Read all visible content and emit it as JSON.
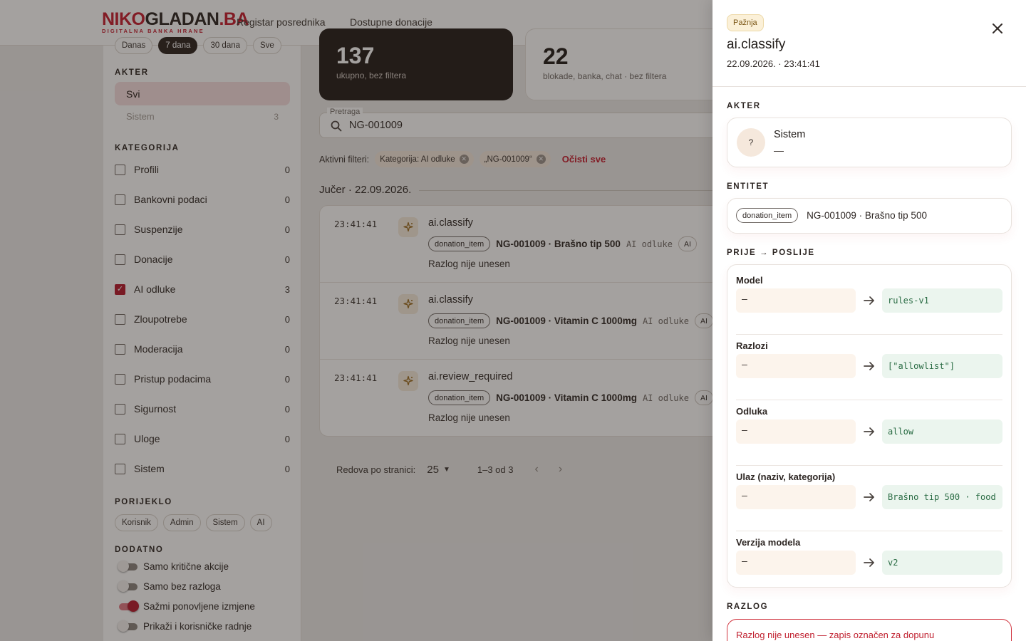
{
  "header": {
    "logo_main_red": "NIKO",
    "logo_main_dark": "GLADAN",
    "logo_main_suffix": ".BA",
    "logo_sub": "DIGITALNA BANKA HRANE",
    "nav": [
      "Registar posrednika",
      "Dostupne donacije"
    ]
  },
  "sidebar": {
    "top_chips": [
      "Danas",
      "7 dana",
      "30 dana",
      "Sve"
    ],
    "actor_title": "AKTER",
    "actors": [
      {
        "label": "Svi",
        "count": ""
      },
      {
        "label": "Sistem",
        "count": "3"
      }
    ],
    "category_title": "KATEGORIJA",
    "categories": [
      {
        "label": "Profili",
        "count": "0",
        "checked": false
      },
      {
        "label": "Bankovni podaci",
        "count": "0",
        "checked": false
      },
      {
        "label": "Suspenzije",
        "count": "0",
        "checked": false
      },
      {
        "label": "Donacije",
        "count": "0",
        "checked": false
      },
      {
        "label": "AI odluke",
        "count": "3",
        "checked": true
      },
      {
        "label": "Zloupotrebe",
        "count": "0",
        "checked": false
      },
      {
        "label": "Moderacija",
        "count": "0",
        "checked": false
      },
      {
        "label": "Pristup podacima",
        "count": "0",
        "checked": false
      },
      {
        "label": "Sigurnost",
        "count": "0",
        "checked": false
      },
      {
        "label": "Uloge",
        "count": "0",
        "checked": false
      },
      {
        "label": "Sistem",
        "count": "0",
        "checked": false
      }
    ],
    "origin_title": "PORIJEKLO",
    "origins": [
      "Korisnik",
      "Admin",
      "Sistem",
      "AI"
    ],
    "extra_title": "DODATNO",
    "toggles": [
      {
        "label": "Samo kritične akcije",
        "on": false
      },
      {
        "label": "Samo bez razloga",
        "on": false
      },
      {
        "label": "Sažmi ponovljene izmjene",
        "on": true
      },
      {
        "label": "Prikaži i korisničke radnje",
        "on": false
      }
    ]
  },
  "stats": {
    "total_num": "137",
    "total_sub": "ukupno, bez filtera",
    "critical_num": "22",
    "critical_sub": "blokade, banka, chat · bez filtera"
  },
  "search": {
    "label": "Pretraga",
    "value": "NG-001009"
  },
  "filters": {
    "label": "Aktivni filteri:",
    "chips": [
      "Kategorija: AI odluke",
      "„NG-001009“"
    ],
    "clear": "Očisti sve"
  },
  "day_heading": "Jučer · 22.09.2026.",
  "events": [
    {
      "time": "23:41:41",
      "action": "ai.classify",
      "entity": "donation_item",
      "ref": "NG-001009 · Brašno tip 500",
      "category": "AI odluke",
      "origin": "AI",
      "reason": "Razlog nije unesen"
    },
    {
      "time": "23:41:41",
      "action": "ai.classify",
      "entity": "donation_item",
      "ref": "NG-001009 · Vitamin C 1000mg",
      "category": "AI odluke",
      "origin": "AI",
      "reason": "Razlog nije unesen"
    },
    {
      "time": "23:41:41",
      "action": "ai.review_required",
      "entity": "donation_item",
      "ref": "NG-001009 · Vitamin C 1000mg",
      "category": "AI odluke",
      "origin": "AI",
      "reason": "Razlog nije unesen"
    }
  ],
  "pager": {
    "label": "Redova po stranici:",
    "value": "25",
    "range": "1–3 od 3"
  },
  "drawer": {
    "badge": "Pažnja",
    "title": "ai.classify",
    "date": "22.09.2026. · 23:41:41",
    "actor_title": "AKTER",
    "actor_avatar": "?",
    "actor_name": "Sistem",
    "actor_role": "—",
    "entity_title": "ENTITET",
    "entity_type": "donation_item",
    "entity_ref": "NG-001009 · Brašno tip 500",
    "diff_title": "PRIJE → POSLIJE",
    "diffs": [
      {
        "label": "Model",
        "old": "—",
        "new": "rules-v1"
      },
      {
        "label": "Razlozi",
        "old": "—",
        "new": "[\"allowlist\"]"
      },
      {
        "label": "Odluka",
        "old": "—",
        "new": "allow"
      },
      {
        "label": "Ulaz (naziv, kategorija)",
        "old": "—",
        "new": "Brašno tip 500 · food"
      },
      {
        "label": "Verzija modela",
        "old": "—",
        "new": "v2"
      }
    ],
    "reason_title": "RAZLOG",
    "reason_text": "Razlog nije unesen — zapis označen za dopunu"
  },
  "colors": {
    "brand": "#c51b2e",
    "dark": "#221a17",
    "warn_bg": "#fbf0d8",
    "new_value": "#2a6c44"
  }
}
